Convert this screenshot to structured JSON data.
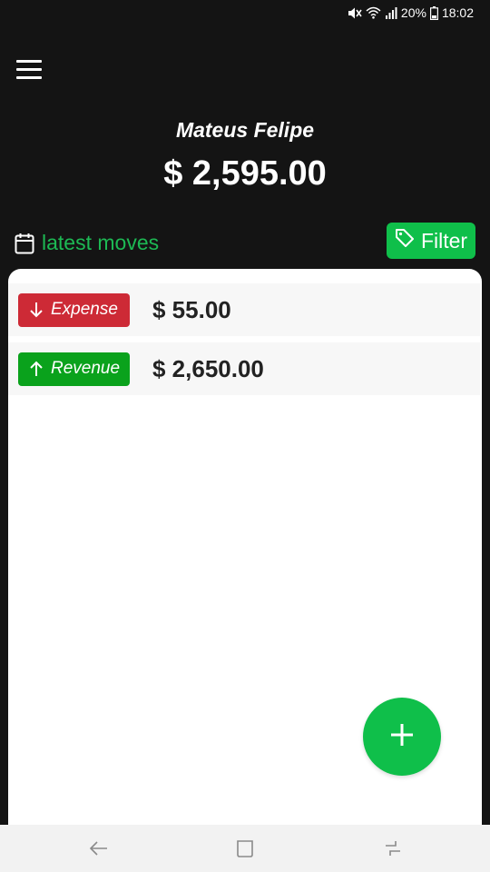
{
  "status_bar": {
    "battery": "20%",
    "time": "18:02",
    "icons": [
      "mute-icon",
      "wifi-icon",
      "signal-icon",
      "battery-icon"
    ]
  },
  "header": {
    "menu_icon": "hamburger-menu-icon",
    "user_name": "Mateus Felipe",
    "balance": "$ 2,595.00"
  },
  "section": {
    "title": "latest moves",
    "title_icon": "calendar-icon",
    "filter_label": "Filter",
    "filter_icon": "tag-icon"
  },
  "moves": [
    {
      "type": "Expense",
      "direction_icon": "arrow-down-icon",
      "amount": "$ 55.00",
      "color": "#cd2a36"
    },
    {
      "type": "Revenue",
      "direction_icon": "arrow-up-icon",
      "amount": "$ 2,650.00",
      "color": "#0aa21c"
    }
  ],
  "fab": {
    "icon": "plus-icon"
  },
  "nav_bar": {
    "buttons": [
      "back-icon",
      "home-icon",
      "recents-icon"
    ]
  },
  "colors": {
    "background": "#141414",
    "accent": "#0fbf4a",
    "latest_text": "#1db954",
    "expense": "#cd2a36",
    "revenue": "#0aa21c"
  }
}
